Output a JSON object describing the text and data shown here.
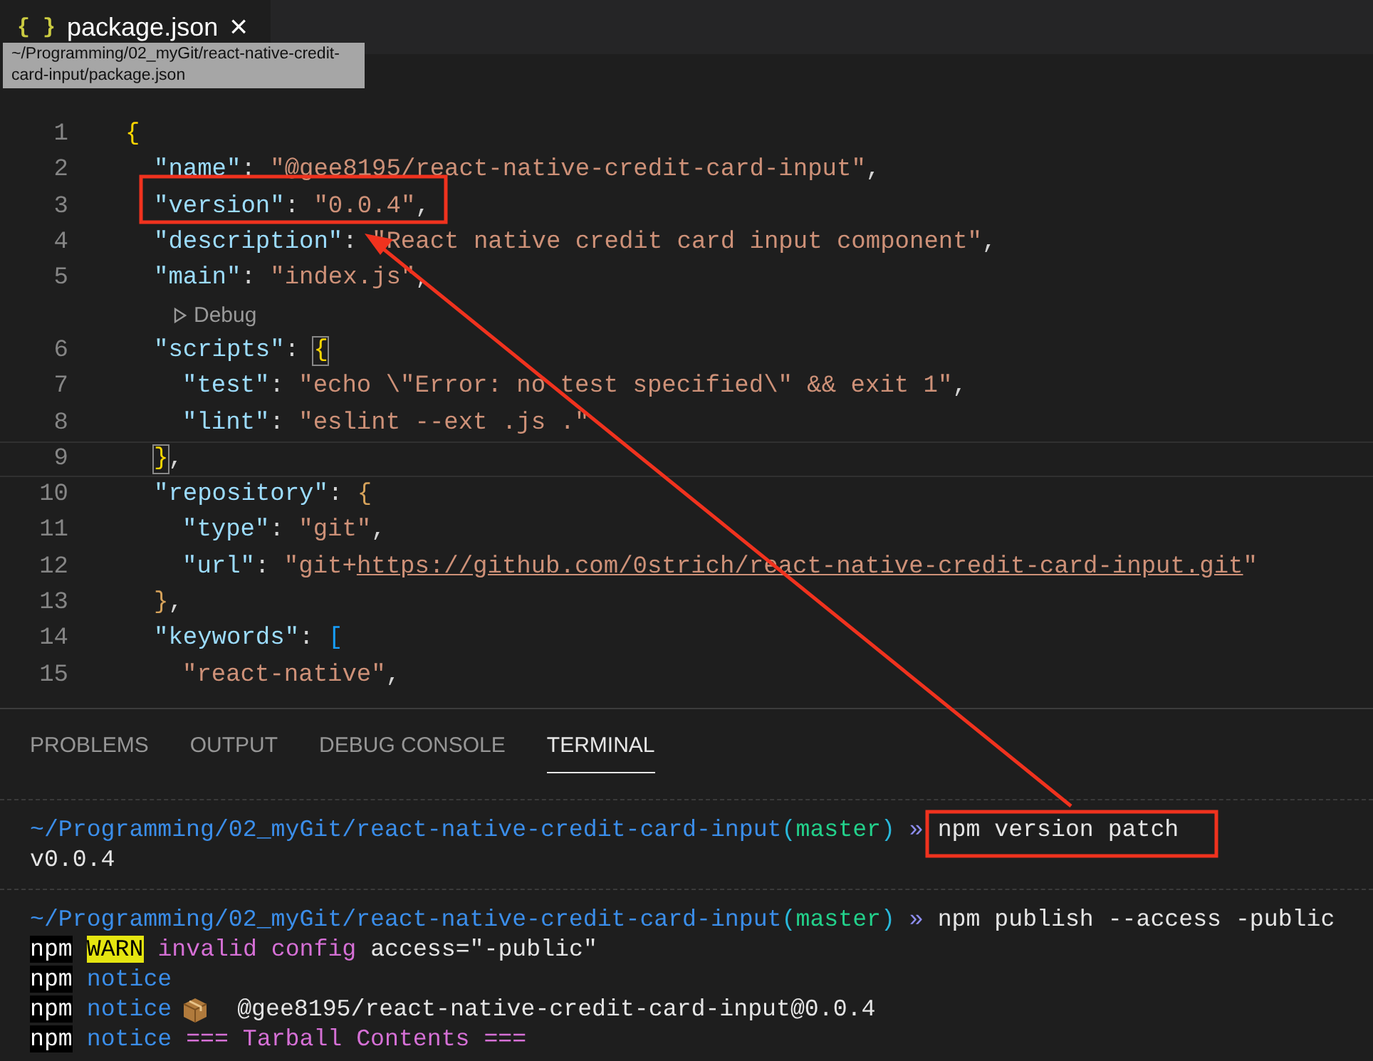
{
  "editor_tab": {
    "icon": "{ }",
    "label": "package.json",
    "close": "×",
    "selected": true
  },
  "tooltip": {
    "text": "~/Programming/02_myGit/react-native-credit-card-input/package.json"
  },
  "code_lines": [
    {
      "kind": "code",
      "number": "1",
      "current": false,
      "tokens": [
        {
          "kind": "brace",
          "text": "{"
        }
      ],
      "children": [
        {
          "kind": "code",
          "number": "2",
          "current": false,
          "tokens": [
            {
              "kind": "key",
              "text": "\"name\""
            },
            {
              "kind": "punct",
              "text": ": "
            },
            {
              "kind": "string",
              "text": "\"@gee8195/react-native-credit-card-input\""
            },
            {
              "kind": "punct",
              "text": ","
            }
          ]
        },
        {
          "kind": "code",
          "number": "3",
          "current": false,
          "tokens": [
            {
              "kind": "key",
              "text": "\"version\""
            },
            {
              "kind": "punct",
              "text": ": "
            },
            {
              "kind": "string",
              "text": "\"0.0.4\""
            },
            {
              "kind": "punct",
              "text": ","
            }
          ]
        },
        {
          "kind": "code",
          "number": "4",
          "current": false,
          "tokens": [
            {
              "kind": "key",
              "text": "\"description\""
            },
            {
              "kind": "punct",
              "text": ": "
            },
            {
              "kind": "string",
              "text": "\"React native credit card input component\""
            },
            {
              "kind": "punct",
              "text": ","
            }
          ]
        },
        {
          "kind": "code",
          "number": "5",
          "current": false,
          "tokens": [
            {
              "kind": "key",
              "text": "\"main\""
            },
            {
              "kind": "punct",
              "text": ": "
            },
            {
              "kind": "string",
              "text": "\"index.js\""
            },
            {
              "kind": "punct",
              "text": ","
            }
          ]
        },
        {
          "kind": "codelens",
          "label": "Debug"
        },
        {
          "kind": "code",
          "number": "6",
          "current": false,
          "tokens": [
            {
              "kind": "key",
              "text": "\"scripts\""
            },
            {
              "kind": "punct",
              "text": ": "
            },
            {
              "kind": "matchbrace",
              "text": "{"
            }
          ],
          "children": [
            {
              "kind": "code",
              "number": "7",
              "current": false,
              "tokens": [
                {
                  "kind": "key",
                  "text": "\"test\""
                },
                {
                  "kind": "punct",
                  "text": ": "
                },
                {
                  "kind": "string",
                  "text": "\"echo \\\"Error: no test specified\\\" && exit 1\""
                },
                {
                  "kind": "punct",
                  "text": ","
                }
              ]
            },
            {
              "kind": "code",
              "number": "8",
              "current": false,
              "tokens": [
                {
                  "kind": "key",
                  "text": "\"lint\""
                },
                {
                  "kind": "punct",
                  "text": ": "
                },
                {
                  "kind": "string",
                  "text": "\"eslint --ext .js .\""
                }
              ]
            }
          ]
        },
        {
          "kind": "code",
          "number": "9",
          "current": true,
          "tokens": [
            {
              "kind": "matchbrace",
              "text": "}"
            },
            {
              "kind": "punct",
              "text": ","
            }
          ]
        },
        {
          "kind": "code",
          "number": "10",
          "current": false,
          "tokens": [
            {
              "kind": "key",
              "text": "\"repository\""
            },
            {
              "kind": "punct",
              "text": ": "
            },
            {
              "kind": "innerbrace",
              "text": "{"
            }
          ],
          "children": [
            {
              "kind": "code",
              "number": "11",
              "current": false,
              "tokens": [
                {
                  "kind": "key",
                  "text": "\"type\""
                },
                {
                  "kind": "punct",
                  "text": ": "
                },
                {
                  "kind": "string",
                  "text": "\"git\""
                },
                {
                  "kind": "punct",
                  "text": ","
                }
              ]
            },
            {
              "kind": "code",
              "number": "12",
              "current": false,
              "tokens": [
                {
                  "kind": "key",
                  "text": "\"url\""
                },
                {
                  "kind": "punct",
                  "text": ": "
                },
                {
                  "kind": "string",
                  "text": "\"git+"
                },
                {
                  "kind": "link",
                  "text": "https://github.com/0strich/react-native-credit-card-input.git"
                },
                {
                  "kind": "string",
                  "text": "\""
                }
              ]
            }
          ]
        },
        {
          "kind": "code",
          "number": "13",
          "current": false,
          "tokens": [
            {
              "kind": "innerbrace",
              "text": "}"
            },
            {
              "kind": "punct",
              "text": ","
            }
          ]
        },
        {
          "kind": "code",
          "number": "14",
          "current": false,
          "tokens": [
            {
              "kind": "key",
              "text": "\"keywords\""
            },
            {
              "kind": "punct",
              "text": ": "
            },
            {
              "kind": "bracket",
              "text": "["
            }
          ],
          "children": [
            {
              "kind": "code",
              "number": "15",
              "current": false,
              "tokens": [
                {
                  "kind": "string",
                  "text": "\"react-native\""
                },
                {
                  "kind": "punct",
                  "text": ","
                }
              ]
            }
          ]
        }
      ]
    }
  ],
  "panel_tabs": [
    {
      "label": "PROBLEMS",
      "selected": false
    },
    {
      "label": "OUTPUT",
      "selected": false
    },
    {
      "label": "DEBUG CONSOLE",
      "selected": false
    },
    {
      "label": "TERMINAL",
      "selected": true
    }
  ],
  "terminal": [
    {
      "kind": "separator"
    },
    {
      "kind": "line",
      "tokens": [
        {
          "kind": "path",
          "text": "~/Programming/02_myGit/react-native-credit-card-input"
        },
        {
          "kind": "paren",
          "text": "("
        },
        {
          "kind": "branch",
          "text": "master"
        },
        {
          "kind": "paren",
          "text": ")"
        },
        {
          "kind": "prompt",
          "text": " » "
        },
        {
          "kind": "command",
          "text": "npm version patch"
        }
      ]
    },
    {
      "kind": "line",
      "tokens": [
        {
          "kind": "text",
          "text": "v0.0.4"
        }
      ]
    },
    {
      "kind": "separator"
    },
    {
      "kind": "line",
      "tokens": [
        {
          "kind": "path",
          "text": "~/Programming/02_myGit/react-native-credit-card-input"
        },
        {
          "kind": "paren",
          "text": "("
        },
        {
          "kind": "branch",
          "text": "master"
        },
        {
          "kind": "paren",
          "text": ")"
        },
        {
          "kind": "prompt",
          "text": " » "
        },
        {
          "kind": "command",
          "text": "npm publish --access -public"
        }
      ]
    },
    {
      "kind": "line",
      "tokens": [
        {
          "kind": "npm",
          "text": "npm"
        },
        {
          "kind": "warn",
          "text": "WARN"
        },
        {
          "kind": "magenta",
          "text": "invalid config"
        },
        {
          "kind": "text",
          "text": " access=\"-public\""
        }
      ]
    },
    {
      "kind": "line",
      "tokens": [
        {
          "kind": "npm",
          "text": "npm"
        },
        {
          "kind": "notice",
          "text": "notice"
        }
      ]
    },
    {
      "kind": "line",
      "tokens": [
        {
          "kind": "npm",
          "text": "npm"
        },
        {
          "kind": "notice",
          "text": "notice"
        },
        {
          "kind": "package"
        },
        {
          "kind": "text",
          "text": " @gee8195/react-native-credit-card-input@0.0.4"
        }
      ]
    },
    {
      "kind": "line",
      "tokens": [
        {
          "kind": "npm",
          "text": "npm"
        },
        {
          "kind": "notice",
          "text": "notice"
        },
        {
          "kind": "magenta",
          "text": " === Tarball Contents ==="
        }
      ]
    }
  ]
}
